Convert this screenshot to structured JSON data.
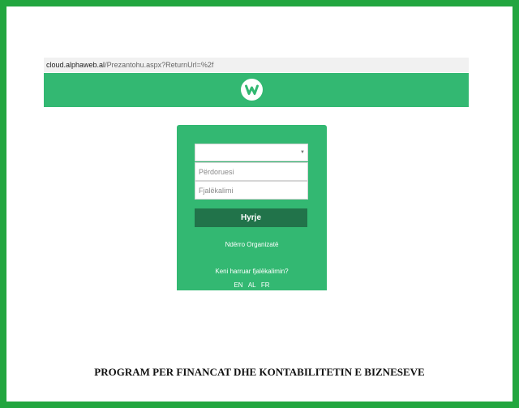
{
  "browser": {
    "url_host": "cloud.alphaweb.al",
    "url_path": "/Prezantohu.aspx?ReturnUrl=%2f"
  },
  "header": {
    "logo_icon": "w-logo-icon",
    "brand_color": "#33b872"
  },
  "login": {
    "organization_select_value": "",
    "username_placeholder": "Përdoruesi",
    "password_placeholder": "Fjalëkalimi",
    "submit_label": "Hyrje",
    "change_org_label": "Ndërro Organizatë",
    "forgot_password_label": "Keni harruar fjalëkalimin?",
    "languages": [
      "EN",
      "AL",
      "FR"
    ]
  },
  "footer": {
    "text": "PROGRAM PER FINANCAT DHE KONTABILITETIN E BIZNESEVE"
  },
  "colors": {
    "frame": "#22a63f",
    "button": "#21734a"
  }
}
